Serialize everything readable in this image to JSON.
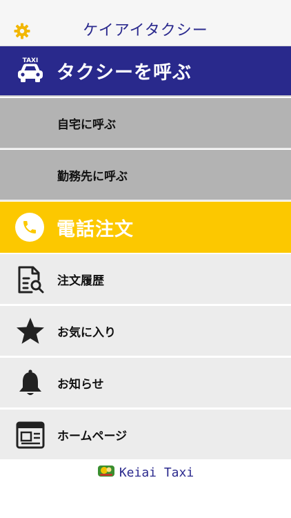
{
  "header": {
    "title": "ケイアイタクシー",
    "settings_icon": "gear-icon",
    "accent_color": "#f2b705"
  },
  "call_taxi": {
    "label": "タクシーを呼ぶ",
    "icon": "taxi-icon",
    "icon_text": "TAXI",
    "background": "#29298c"
  },
  "call_options": [
    {
      "label": "自宅に呼ぶ"
    },
    {
      "label": "勤務先に呼ぶ"
    }
  ],
  "phone_order": {
    "label": "電話注文",
    "icon": "phone-icon",
    "background": "#fcc800"
  },
  "menu": [
    {
      "label": "注文履歴",
      "icon": "order-history-icon"
    },
    {
      "label": "お気に入り",
      "icon": "star-icon"
    },
    {
      "label": "お知らせ",
      "icon": "bell-icon"
    },
    {
      "label": "ホームページ",
      "icon": "webpage-icon"
    }
  ],
  "footer": {
    "brand": "Keiai Taxi",
    "logo": "keiai-logo"
  }
}
